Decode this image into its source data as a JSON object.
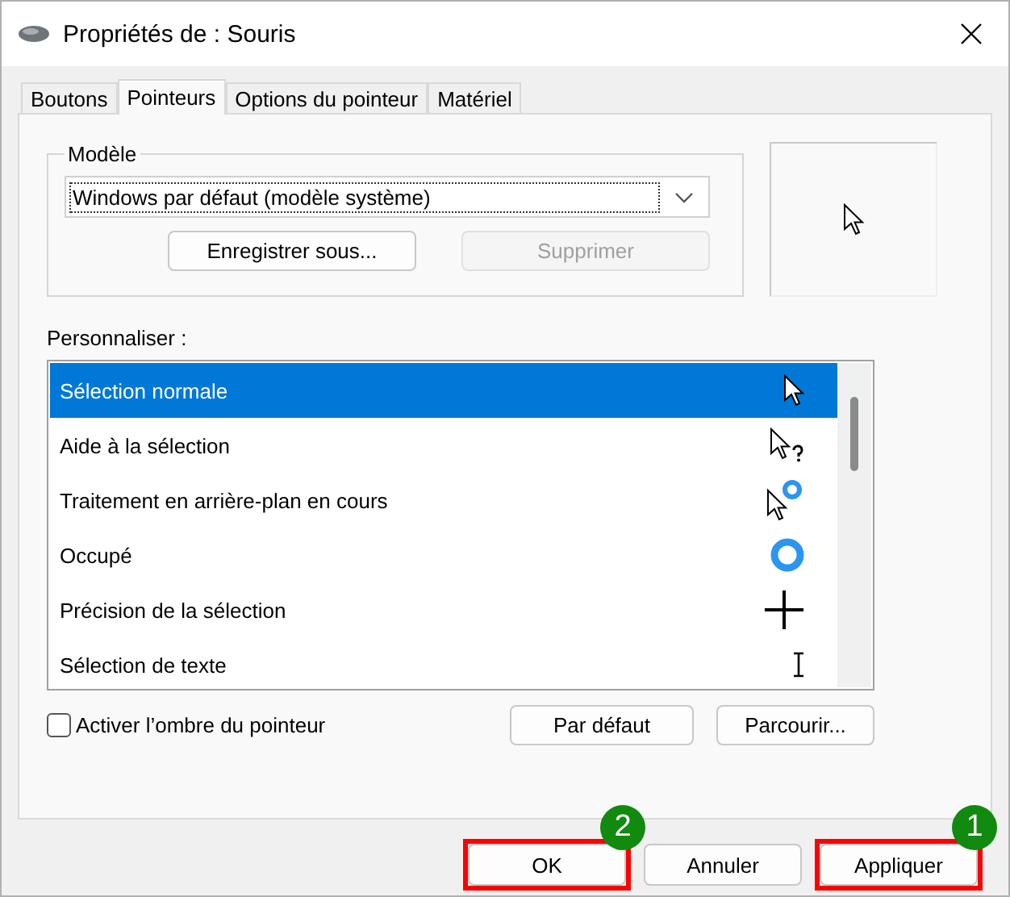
{
  "window": {
    "title": "Propriétés de : Souris"
  },
  "tabs": [
    {
      "label": "Boutons",
      "selected": false
    },
    {
      "label": "Pointeurs",
      "selected": true
    },
    {
      "label": "Options du pointeur",
      "selected": false
    },
    {
      "label": "Matériel",
      "selected": false
    }
  ],
  "scheme": {
    "label": "Modèle",
    "value": "Windows par défaut (modèle système)",
    "buttons": [
      {
        "label": "Enregistrer sous...",
        "disabled": false
      },
      {
        "label": "Supprimer",
        "disabled": true
      }
    ]
  },
  "customize": {
    "label": "Personnaliser :",
    "items": [
      {
        "label": "Sélection normale",
        "kind": "arrow",
        "selected": true
      },
      {
        "label": "Aide à la sélection",
        "kind": "help",
        "selected": false
      },
      {
        "label": "Traitement en arrière-plan en cours",
        "kind": "working",
        "selected": false
      },
      {
        "label": "Occupé",
        "kind": "busy",
        "selected": false
      },
      {
        "label": "Précision de la sélection",
        "kind": "cross",
        "selected": false
      },
      {
        "label": "Sélection de texte",
        "kind": "beam",
        "selected": false
      }
    ]
  },
  "shadow": {
    "label": "Activer l’ombre du pointeur",
    "checked": false
  },
  "list_buttons": [
    "Par défaut",
    "Parcourir..."
  ],
  "footer_buttons": [
    {
      "label": "OK",
      "annotation": "2"
    },
    {
      "label": "Annuler"
    },
    {
      "label": "Appliquer",
      "annotation": "1"
    }
  ]
}
